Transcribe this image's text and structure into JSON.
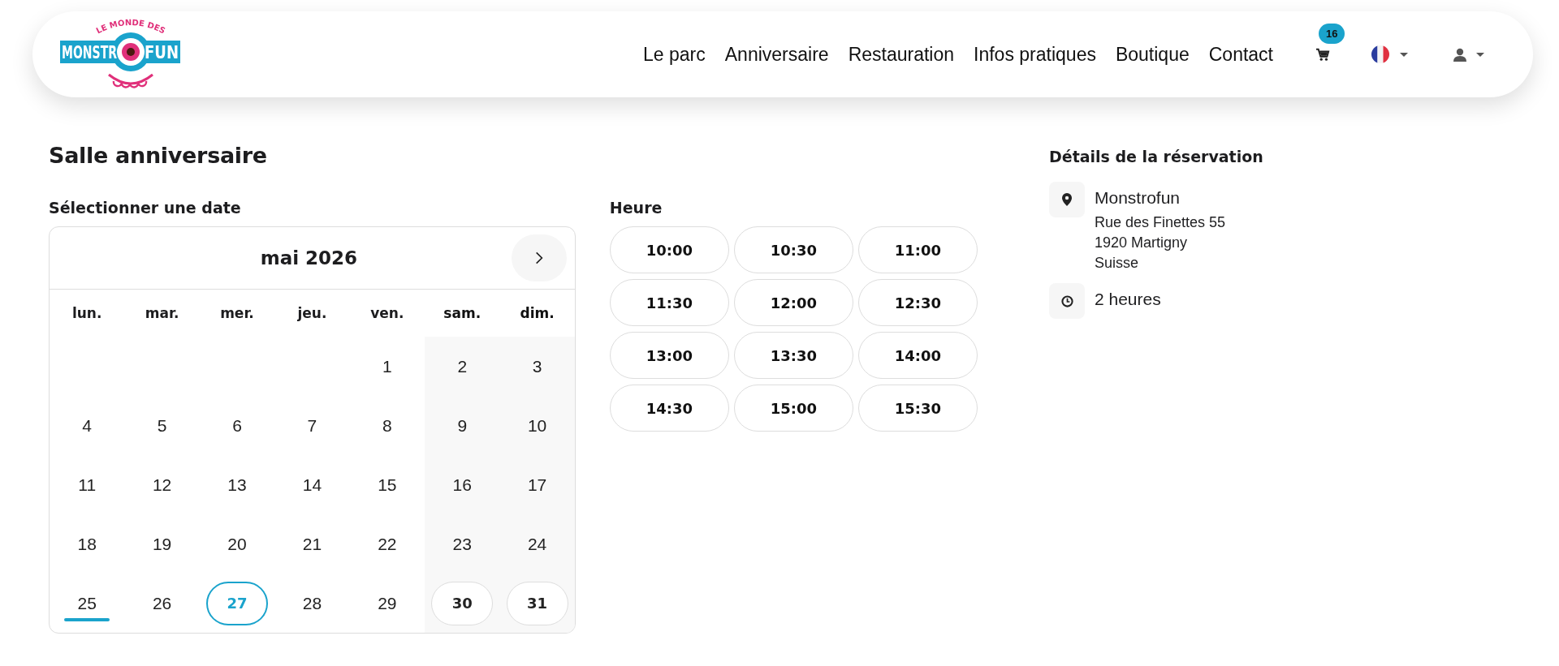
{
  "header": {
    "logo": {
      "top_text": "LE MONDE DES",
      "left_text": "MONSTR",
      "right_text": "FUN"
    },
    "nav": [
      "Le parc",
      "Anniversaire",
      "Restauration",
      "Infos pratiques",
      "Boutique",
      "Contact"
    ],
    "cart_count": "16"
  },
  "title": "Salle anniversaire",
  "date_label": "Sélectionner une date",
  "calendar": {
    "month": "mai 2026",
    "weekdays": [
      {
        "label": "lun.",
        "weekend": false
      },
      {
        "label": "mar.",
        "weekend": false
      },
      {
        "label": "mer.",
        "weekend": false
      },
      {
        "label": "jeu.",
        "weekend": false
      },
      {
        "label": "ven.",
        "weekend": false
      },
      {
        "label": "sam.",
        "weekend": true
      },
      {
        "label": "dim.",
        "weekend": true
      }
    ],
    "weeks": [
      [
        {
          "label": "1",
          "today": false,
          "selected": false,
          "available": false
        },
        {
          "label": "2",
          "today": false,
          "selected": false,
          "available": false
        },
        {
          "label": "3",
          "today": false,
          "selected": false,
          "available": false
        }
      ],
      [
        {
          "label": "4",
          "today": false,
          "selected": false,
          "available": false
        },
        {
          "label": "5",
          "today": false,
          "selected": false,
          "available": false
        },
        {
          "label": "6",
          "today": false,
          "selected": false,
          "available": false
        },
        {
          "label": "7",
          "today": false,
          "selected": false,
          "available": false
        },
        {
          "label": "8",
          "today": false,
          "selected": false,
          "available": false
        },
        {
          "label": "9",
          "today": false,
          "selected": false,
          "available": false
        },
        {
          "label": "10",
          "today": false,
          "selected": false,
          "available": false
        }
      ],
      [
        {
          "label": "11",
          "today": false,
          "selected": false,
          "available": false
        },
        {
          "label": "12",
          "today": false,
          "selected": false,
          "available": false
        },
        {
          "label": "13",
          "today": false,
          "selected": false,
          "available": false
        },
        {
          "label": "14",
          "today": false,
          "selected": false,
          "available": false
        },
        {
          "label": "15",
          "today": false,
          "selected": false,
          "available": false
        },
        {
          "label": "16",
          "today": false,
          "selected": false,
          "available": false
        },
        {
          "label": "17",
          "today": false,
          "selected": false,
          "available": false
        }
      ],
      [
        {
          "label": "18",
          "today": false,
          "selected": false,
          "available": false
        },
        {
          "label": "19",
          "today": false,
          "selected": false,
          "available": false
        },
        {
          "label": "20",
          "today": false,
          "selected": false,
          "available": false
        },
        {
          "label": "21",
          "today": false,
          "selected": false,
          "available": false
        },
        {
          "label": "22",
          "today": false,
          "selected": false,
          "available": false
        },
        {
          "label": "23",
          "today": false,
          "selected": false,
          "available": false
        },
        {
          "label": "24",
          "today": false,
          "selected": false,
          "available": false
        }
      ],
      [
        {
          "label": "25",
          "today": true,
          "selected": false,
          "available": false
        },
        {
          "label": "26",
          "today": false,
          "selected": false,
          "available": false
        },
        {
          "label": "27",
          "today": false,
          "selected": true,
          "available": true
        },
        {
          "label": "28",
          "today": false,
          "selected": false,
          "available": false
        },
        {
          "label": "29",
          "today": false,
          "selected": false,
          "available": false
        },
        {
          "label": "30",
          "today": false,
          "selected": false,
          "available": true
        },
        {
          "label": "31",
          "today": false,
          "selected": false,
          "available": true
        }
      ]
    ]
  },
  "time_label": "Heure",
  "times": [
    {
      "label": "10:00",
      "selected": false
    },
    {
      "label": "10:30",
      "selected": false
    },
    {
      "label": "11:00",
      "selected": false
    },
    {
      "label": "11:30",
      "selected": false
    },
    {
      "label": "12:00",
      "selected": false
    },
    {
      "label": "12:30",
      "selected": false
    },
    {
      "label": "13:00",
      "selected": false
    },
    {
      "label": "13:30",
      "selected": false
    },
    {
      "label": "14:00",
      "selected": false
    },
    {
      "label": "14:30",
      "selected": false
    },
    {
      "label": "15:00",
      "selected": false
    },
    {
      "label": "15:30",
      "selected": false
    }
  ],
  "details": {
    "title": "Détails de la réservation",
    "items": [
      {
        "kind": "location",
        "name": "Monstrofun",
        "lines": [
          "Rue des Finettes 55",
          "1920 Martigny",
          "Suisse"
        ]
      },
      {
        "kind": "duration",
        "name": "2 heures"
      }
    ]
  }
}
